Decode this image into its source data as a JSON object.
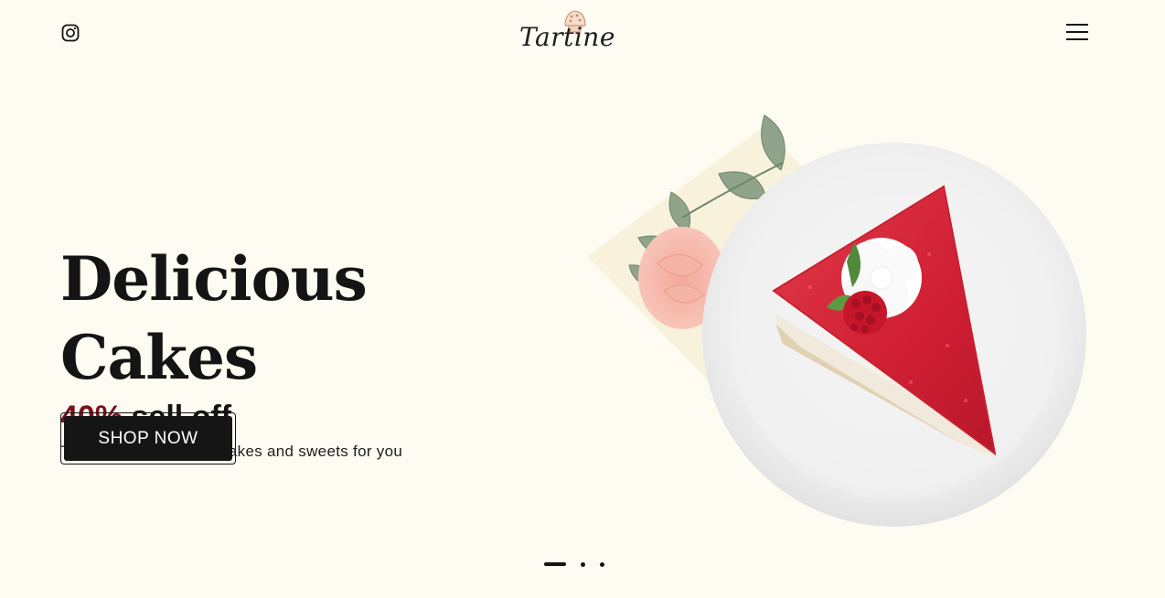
{
  "header": {
    "logo_text": "Tartine",
    "instagram_icon": "instagram-icon",
    "menu_icon": "hamburger-menu-icon"
  },
  "hero": {
    "title": "Delicious Cakes",
    "discount": "40%",
    "discount_suffix": "sell off",
    "description": "Tartine offers the best cakes and sweets for you",
    "cta_label": "SHOP NOW",
    "image_alt": "Slice of raspberry cheesecake on a white plate with cream rose and leaves"
  },
  "slider": {
    "total": 3,
    "active": 1
  },
  "colors": {
    "background": "#fefcf2",
    "accent": "#7a0f1e",
    "button": "#151515",
    "text": "#141414"
  }
}
